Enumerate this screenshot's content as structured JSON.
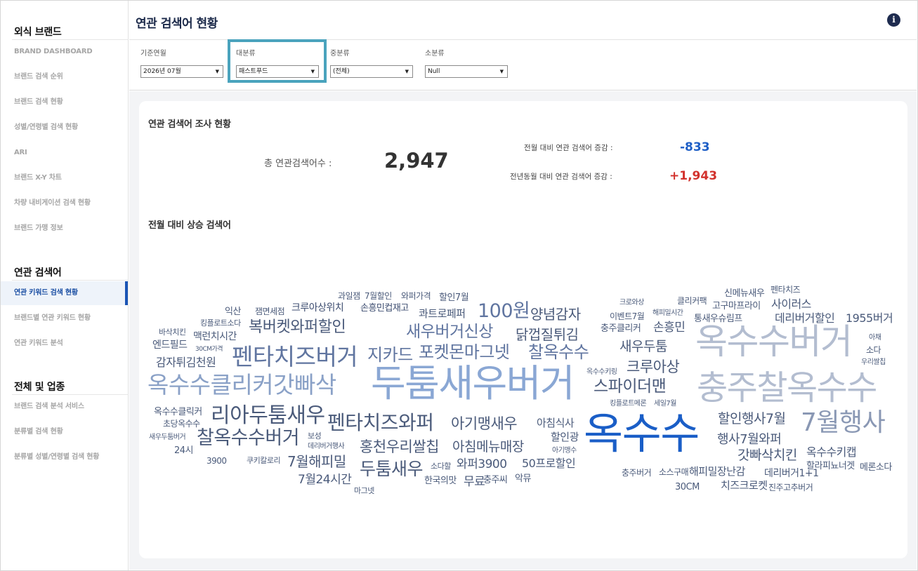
{
  "sidebar": {
    "section1": "외식 브랜드",
    "items1": [
      "BRAND DASHBOARD",
      "브랜드 검색 순위",
      "브랜드 검색 현황",
      "성별/연령별 검색 현황",
      "ARI",
      "브랜드 X-Y 차트",
      "차량 내비게이션 검색 현황",
      "브랜드 가맹 정보"
    ],
    "section2": "연관 검색어",
    "items2": [
      "연관 키워드 검색 현황",
      "브랜드별 연관 키워드 현황",
      "연관 키워드 분석"
    ],
    "section3": "전체 및 업종",
    "items3": [
      "브랜드 검색 분석 서비스",
      "분류별 검색 현황",
      "분류별 성별/연령별 검색 현황"
    ]
  },
  "header": {
    "title": "연관 검색어 현황",
    "info_icon": "i",
    "filters": [
      {
        "label": "기준연월",
        "value": "2026년 07월"
      },
      {
        "label": "대분류",
        "value": "패스트푸드"
      },
      {
        "label": "중분류",
        "value": "(전체)"
      },
      {
        "label": "소분류",
        "value": "Null"
      }
    ]
  },
  "survey": {
    "title": "연관 검색어 조사 현황",
    "total_label": "총 연관검색어수 :",
    "total_value": "2,947",
    "mom_label": "전월 대비 연관 검색어 증감 :",
    "mom_value": "-833",
    "yoy_label": "전년동월 대비 연관 검색어 증감 :",
    "yoy_value": "+1,943",
    "colors": {
      "negative": "#1f5fc6",
      "positive": "#d2322d"
    }
  },
  "rising": {
    "title": "전월 대비 상승 검색어",
    "words": [
      "과일잼",
      "7월할인",
      "와퍼가격",
      "할인7월",
      "익산",
      "잼면세점",
      "크루아상위치",
      "손흥민컵재고",
      "콰트로페퍼",
      "100원",
      "양념감자",
      "킹플로트소다",
      "복버켓와퍼할인",
      "새우버거신상",
      "닭껍질튀김",
      "바삭치킨",
      "맥런치시간",
      "엔드필드",
      "30CM가격",
      "펜타치즈버거",
      "지카드",
      "포켓몬마그넷",
      "찰옥수수",
      "감자튀김천원",
      "옥수수클리커갓빠삭",
      "두툼새우버거",
      "옥수수클릭커",
      "리아두툼새우",
      "초당옥수수",
      "펜타치즈와퍼",
      "아기맹새우",
      "아침식사",
      "새우두툼버거",
      "보성",
      "찰옥수수버거",
      "할인광",
      "24시",
      "데리버거행사",
      "홍천우리쌀칩",
      "아침메뉴매장",
      "아기맹수",
      "3900",
      "쿠키칼로리",
      "7월해피밀",
      "두툼새우",
      "소다할",
      "와퍼3900",
      "50프로할인",
      "7월24시간",
      "한국의맛",
      "무료",
      "충주씨",
      "악뮤",
      "마그넷",
      "크로와상",
      "클리커팩",
      "신메뉴새우",
      "펜타치즈",
      "이벤트7월",
      "해피밀시간",
      "고구마프라이",
      "사이러스",
      "충주클리커",
      "손흥민",
      "통새우슈림프",
      "데리버거할인",
      "1955버거",
      "옥수수버거",
      "아채",
      "소다",
      "우리쌀칩",
      "새우두툼",
      "크루아상",
      "옥수수키링",
      "스파이더맨",
      "충주찰옥수수",
      "킹플로트메론",
      "세일7월",
      "옥수수",
      "할인행사7월",
      "7월행사",
      "행사7월와퍼",
      "갓빠삭치킨",
      "옥수수키캡",
      "할라피뇨너겟",
      "메론소다",
      "충주버거",
      "소스구매",
      "해피밀장난감",
      "데리버거1+1",
      "30CM",
      "치즈크로켓",
      "진주고추버거"
    ]
  }
}
